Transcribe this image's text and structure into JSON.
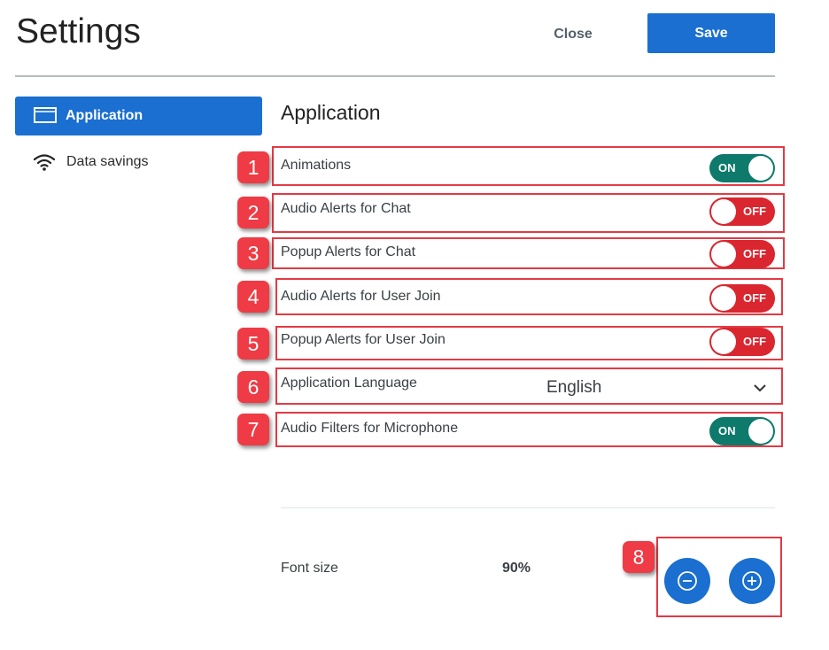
{
  "header": {
    "title": "Settings",
    "close_label": "Close",
    "save_label": "Save"
  },
  "sidebar": {
    "items": [
      {
        "label": "Application",
        "icon": "window-icon",
        "active": true
      },
      {
        "label": "Data savings",
        "icon": "wifi-icon",
        "active": false
      }
    ]
  },
  "main": {
    "title": "Application",
    "settings": [
      {
        "badge": "1",
        "label": "Animations",
        "state": "ON"
      },
      {
        "badge": "2",
        "label": "Audio Alerts for Chat",
        "state": "OFF"
      },
      {
        "badge": "3",
        "label": "Popup Alerts for Chat",
        "state": "OFF"
      },
      {
        "badge": "4",
        "label": "Audio Alerts for User Join",
        "state": "OFF"
      },
      {
        "badge": "5",
        "label": "Popup Alerts for User Join",
        "state": "OFF"
      },
      {
        "badge": "6",
        "label": "Application Language",
        "value": "English"
      },
      {
        "badge": "7",
        "label": "Audio Filters for Microphone",
        "state": "ON"
      }
    ],
    "font_size": {
      "badge": "8",
      "label": "Font size",
      "value": "90%"
    }
  },
  "colors": {
    "accent": "#1a6fd0",
    "toggle_on": "#0d7a6b",
    "toggle_off": "#d9262f",
    "annotation": "#ef3b45"
  }
}
